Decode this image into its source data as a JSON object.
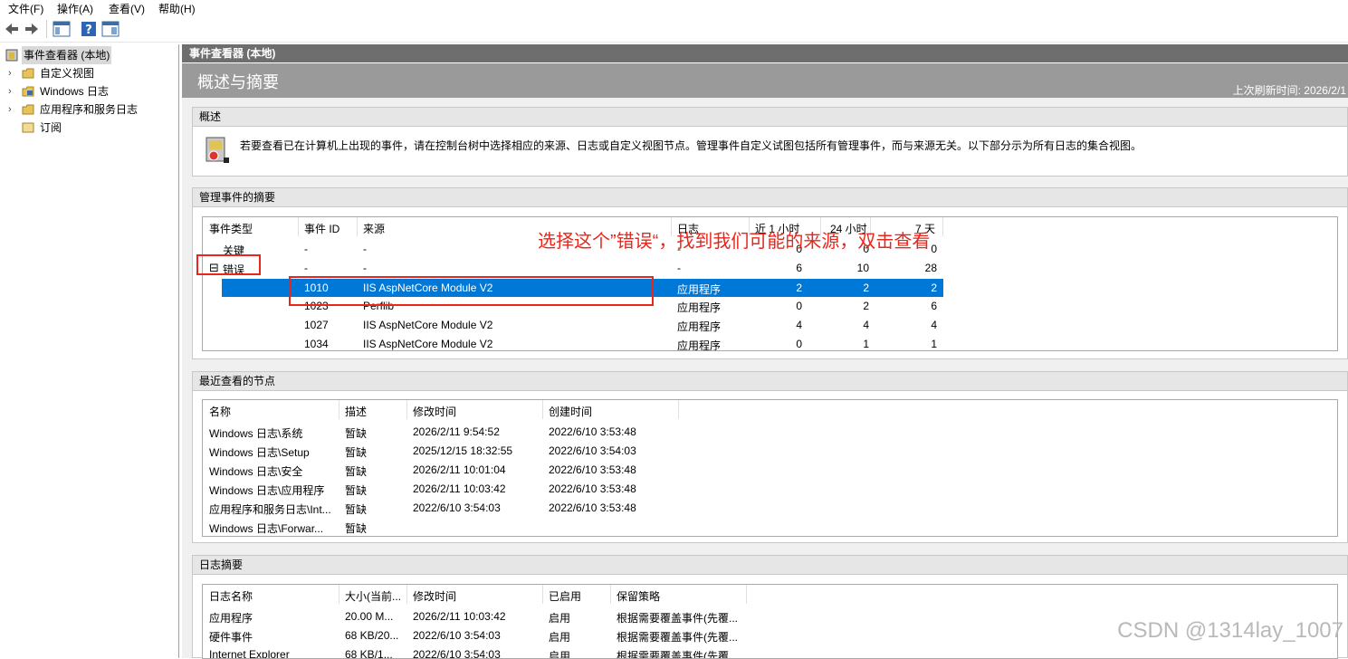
{
  "menu": [
    "文件(F)",
    "操作(A)",
    "查看(V)",
    "帮助(H)"
  ],
  "tree": {
    "root": "事件查看器 (本地)",
    "items": [
      "自定义视图",
      "Windows 日志",
      "应用程序和服务日志",
      "订阅"
    ]
  },
  "header": {
    "pane_title": "事件查看器 (本地)",
    "page_title": "概述与摘要",
    "refresh": "上次刷新时间: 2026/2/1"
  },
  "overview": {
    "title": "概述",
    "text": "若要查看已在计算机上出现的事件，请在控制台树中选择相应的来源、日志或自定义视图节点。管理事件自定义试图包括所有管理事件，而与来源无关。以下部分示为所有日志的集合视图。"
  },
  "admin": {
    "title": "管理事件的摘要",
    "columns": [
      "事件类型",
      "事件 ID",
      "来源",
      "日志",
      "近 1 小时",
      "24 小时",
      "7 天"
    ],
    "rows": [
      [
        "关键",
        "-",
        "-",
        "-",
        "0",
        "0",
        "0"
      ],
      [
        "错误",
        "-",
        "-",
        "-",
        "6",
        "10",
        "28"
      ],
      [
        "",
        "1010",
        "IIS AspNetCore Module V2",
        "应用程序",
        "2",
        "2",
        "2"
      ],
      [
        "",
        "1023",
        "Perflib",
        "应用程序",
        "0",
        "2",
        "6"
      ],
      [
        "",
        "1027",
        "IIS AspNetCore Module V2",
        "应用程序",
        "4",
        "4",
        "4"
      ],
      [
        "",
        "1034",
        "IIS AspNetCore Module V2",
        "应用程序",
        "0",
        "1",
        "1"
      ]
    ],
    "expander": "⊟"
  },
  "recent": {
    "title": "最近查看的节点",
    "columns": [
      "名称",
      "描述",
      "修改时间",
      "创建时间"
    ],
    "rows": [
      [
        "Windows 日志\\系统",
        "暂缺",
        "2026/2/11 9:54:52",
        "2022/6/10 3:53:48"
      ],
      [
        "Windows 日志\\Setup",
        "暂缺",
        "2025/12/15 18:32:55",
        "2022/6/10 3:54:03"
      ],
      [
        "Windows 日志\\安全",
        "暂缺",
        "2026/2/11 10:01:04",
        "2022/6/10 3:53:48"
      ],
      [
        "Windows 日志\\应用程序",
        "暂缺",
        "2026/2/11 10:03:42",
        "2022/6/10 3:53:48"
      ],
      [
        "应用程序和服务日志\\Int...",
        "暂缺",
        "2022/6/10 3:54:03",
        "2022/6/10 3:53:48"
      ],
      [
        "Windows 日志\\Forwar...",
        "暂缺",
        "",
        ""
      ]
    ]
  },
  "logsummary": {
    "title": "日志摘要",
    "columns": [
      "日志名称",
      "大小(当前...",
      "修改时间",
      "已启用",
      "保留策略"
    ],
    "rows": [
      [
        "应用程序",
        "20.00 M...",
        "2026/2/11 10:03:42",
        "启用",
        "根据需要覆盖事件(先覆..."
      ],
      [
        "硬件事件",
        "68 KB/20...",
        "2022/6/10 3:54:03",
        "启用",
        "根据需要覆盖事件(先覆..."
      ],
      [
        "Internet Explorer",
        "68 KB/1...",
        "2022/6/10 3:54:03",
        "启用",
        "根据需要覆盖事件(先覆..."
      ]
    ]
  },
  "annotation": "选择这个”错误“，找到我们可能的来源，双击查看",
  "watermark": "CSDN @1314lay_1007",
  "colors": {
    "selection": "#0078d7",
    "annotation": "#e8261c"
  }
}
